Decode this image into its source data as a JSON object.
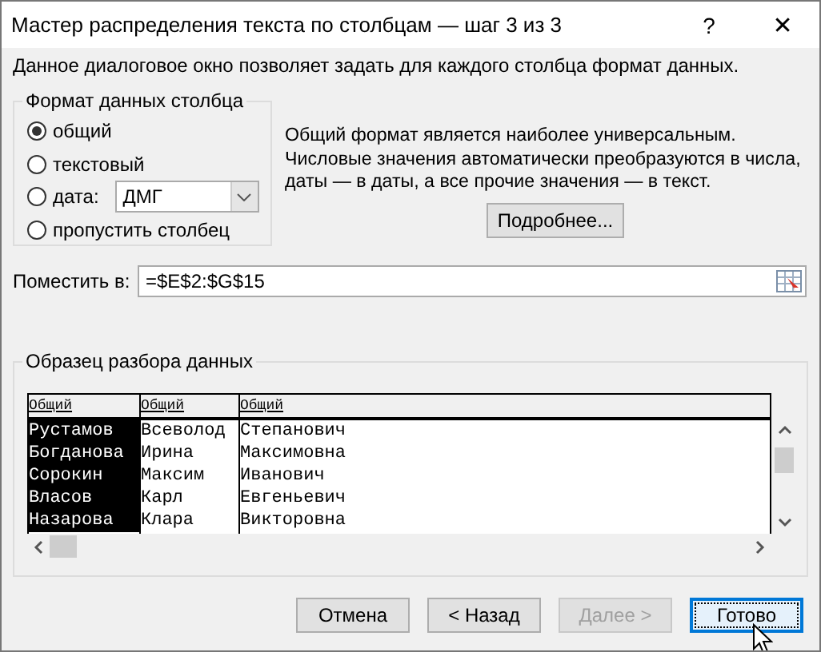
{
  "window": {
    "title": "Мастер распределения текста по столбцам — шаг 3 из 3",
    "help": "?",
    "close": "✕"
  },
  "intro": "Данное диалоговое окно позволяет задать для каждого столбца формат данных.",
  "format_group": {
    "title": "Формат данных столбца",
    "options": [
      {
        "label": "общий",
        "selected": true,
        "kind": "plain"
      },
      {
        "label": "текстовый",
        "selected": false,
        "kind": "plain"
      },
      {
        "label": "дата:",
        "selected": false,
        "kind": "date",
        "dropdown": "ДМГ"
      },
      {
        "label": "пропустить столбец",
        "selected": false,
        "kind": "plain"
      }
    ]
  },
  "description": "Общий формат является наиболее универсальным. Числовые значения автоматически преобразуются в числа, даты — в даты, а все прочие значения — в текст.",
  "details_button": "Подробнее...",
  "destination": {
    "label": "Поместить в:",
    "value": "=$E$2:$G$15"
  },
  "preview": {
    "title": "Образец разбора данных",
    "columns": [
      {
        "header": "Общий",
        "selected": true,
        "cells": [
          "Рустамов",
          "Богданова",
          "Сорокин",
          "Власов",
          "Назарова"
        ]
      },
      {
        "header": "Общий",
        "selected": false,
        "cells": [
          "Всеволод",
          "Ирина",
          "Максим",
          "Карл",
          "Клара"
        ]
      },
      {
        "header": "Общий",
        "selected": false,
        "cells": [
          "Степанович",
          "Максимовна",
          "Иванович",
          "Евгеньевич",
          "Викторовна"
        ]
      }
    ]
  },
  "buttons": [
    {
      "label": "Отмена",
      "disabled": false,
      "default": false
    },
    {
      "label": "< Назад",
      "disabled": false,
      "default": false
    },
    {
      "label": "Далее >",
      "disabled": true,
      "default": false
    },
    {
      "label": "Готово",
      "disabled": false,
      "default": true
    }
  ]
}
